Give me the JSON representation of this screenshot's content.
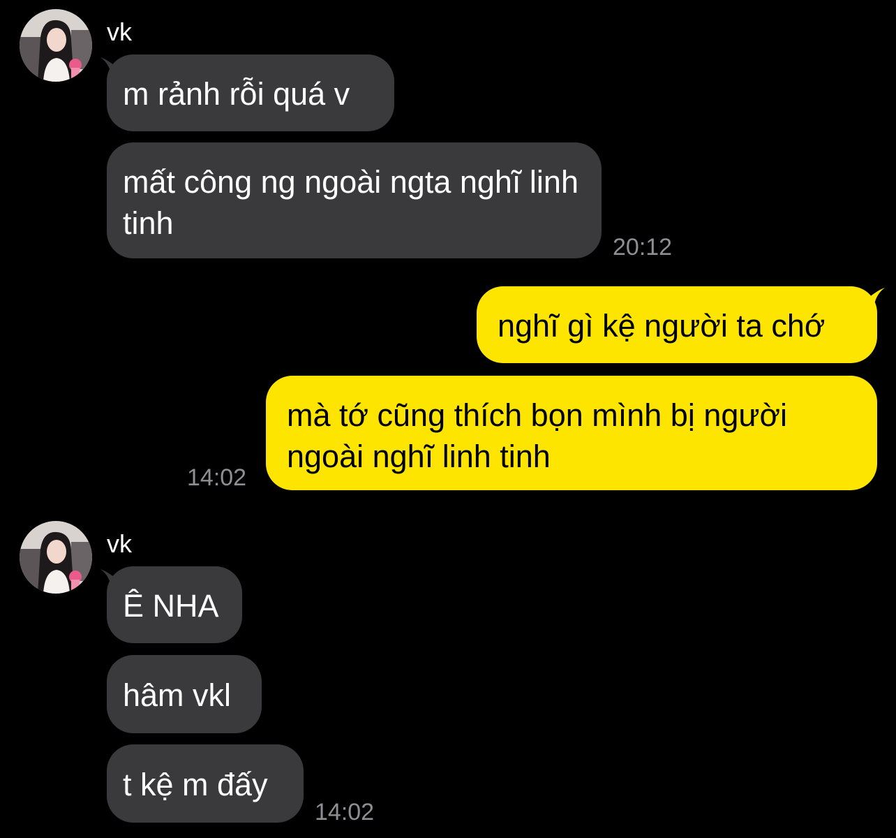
{
  "colors": {
    "background": "#000000",
    "incoming_bubble": "#3a3a3c",
    "incoming_text": "#ffffff",
    "outgoing_bubble": "#fee500",
    "outgoing_text": "#000000",
    "timestamp": "#8e8e93"
  },
  "groups": [
    {
      "direction": "incoming",
      "sender": "vk",
      "avatar_icon": "user-avatar-photo",
      "messages": [
        "m rảnh rỗi quá v",
        "mất công ng ngoài ngta nghĩ linh tinh"
      ],
      "time": "20:12"
    },
    {
      "direction": "outgoing",
      "messages": [
        "nghĩ gì kệ người ta chớ",
        "mà tớ cũng thích bọn mình bị người ngoài nghĩ linh tinh"
      ],
      "time": "14:02"
    },
    {
      "direction": "incoming",
      "sender": "vk",
      "avatar_icon": "user-avatar-photo",
      "messages": [
        "Ê NHA",
        "hâm vkl",
        "t kệ m đấy"
      ],
      "time": "14:02"
    }
  ]
}
